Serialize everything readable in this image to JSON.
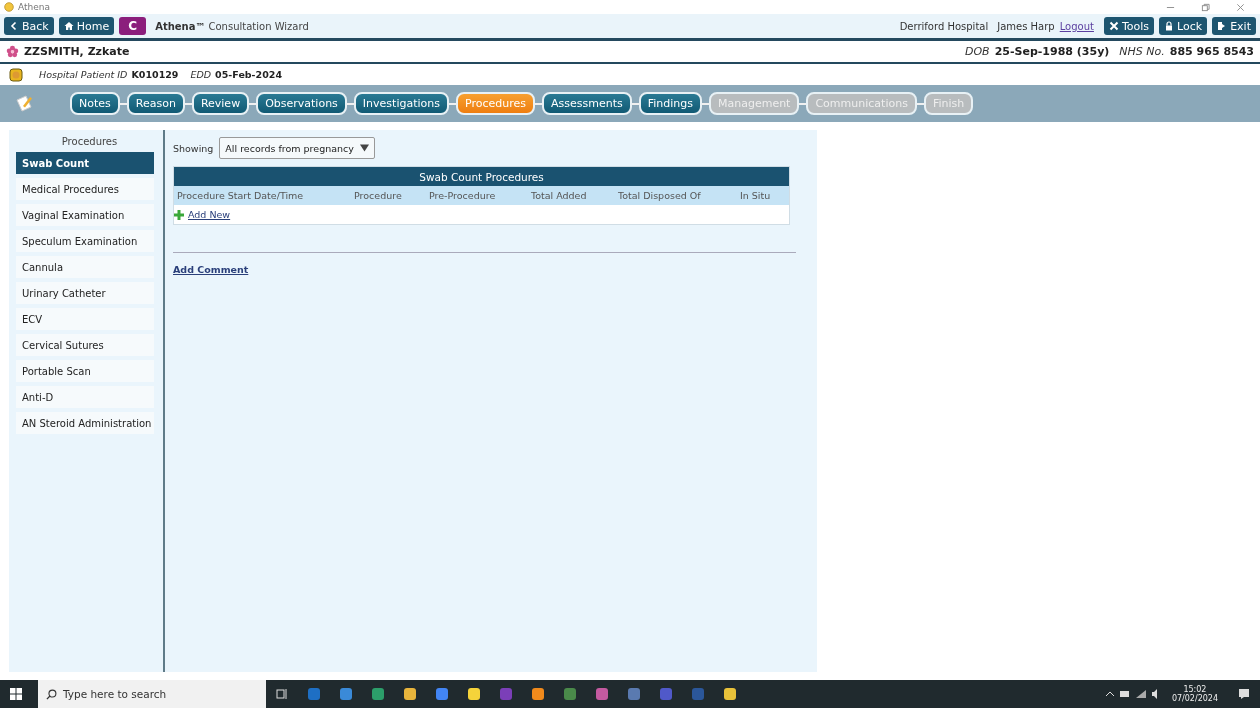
{
  "window": {
    "title": "Athena"
  },
  "toolbar": {
    "buttons": [
      {
        "label": "Back"
      },
      {
        "label": "Home"
      }
    ],
    "c_button": "C",
    "app_name": "Athena™",
    "app_subtitle": "Consultation Wizard",
    "hospital": "Derriford Hospital",
    "user": "James Harp",
    "logout": "Logout",
    "right_buttons": [
      {
        "label": "Tools"
      },
      {
        "label": "Lock"
      },
      {
        "label": "Exit"
      }
    ]
  },
  "patient": {
    "name": "ZZSMITH, Zzkate",
    "dob_label": "DOB",
    "dob": "25-Sep-1988 (35y)",
    "nhs_label": "NHS No.",
    "nhs": "885 965 8543",
    "id_label": "Hospital Patient ID",
    "id": "K010129",
    "edd_label": "EDD",
    "edd": "05-Feb-2024"
  },
  "steps": [
    {
      "label": "Notes",
      "selected": false,
      "disabled": false
    },
    {
      "label": "Reason",
      "selected": false,
      "disabled": false
    },
    {
      "label": "Review",
      "selected": false,
      "disabled": false
    },
    {
      "label": "Observations",
      "selected": false,
      "disabled": false
    },
    {
      "label": "Investigations",
      "selected": false,
      "disabled": false
    },
    {
      "label": "Procedures",
      "selected": true,
      "disabled": false
    },
    {
      "label": "Assessments",
      "selected": false,
      "disabled": false
    },
    {
      "label": "Findings",
      "selected": false,
      "disabled": false
    },
    {
      "label": "Management",
      "selected": false,
      "disabled": true
    },
    {
      "label": "Communications",
      "selected": false,
      "disabled": true
    },
    {
      "label": "Finish",
      "selected": false,
      "disabled": true
    }
  ],
  "sidebar": {
    "title": "Procedures",
    "items": [
      {
        "label": "Swab Count",
        "selected": true
      },
      {
        "label": "Medical Procedures",
        "selected": false
      },
      {
        "label": "Vaginal Examination",
        "selected": false
      },
      {
        "label": "Speculum Examination",
        "selected": false
      },
      {
        "label": "Cannula",
        "selected": false
      },
      {
        "label": "Urinary Catheter",
        "selected": false
      },
      {
        "label": "ECV",
        "selected": false
      },
      {
        "label": "Cervical Sutures",
        "selected": false
      },
      {
        "label": "Portable Scan",
        "selected": false
      },
      {
        "label": "Anti-D",
        "selected": false
      },
      {
        "label": "AN Steroid Administration",
        "selected": false
      }
    ]
  },
  "filter": {
    "label": "Showing",
    "value": "All records from pregnancy"
  },
  "table": {
    "title": "Swab Count Procedures",
    "columns": [
      "Procedure Start Date/Time",
      "Procedure",
      "Pre-Procedure",
      "Total Added",
      "Total Disposed Of",
      "In Situ"
    ],
    "add_new": "Add New"
  },
  "add_comment": "Add Comment",
  "taskbar": {
    "search_placeholder": "Type here to search",
    "time": "15:02",
    "date": "07/02/2024"
  }
}
